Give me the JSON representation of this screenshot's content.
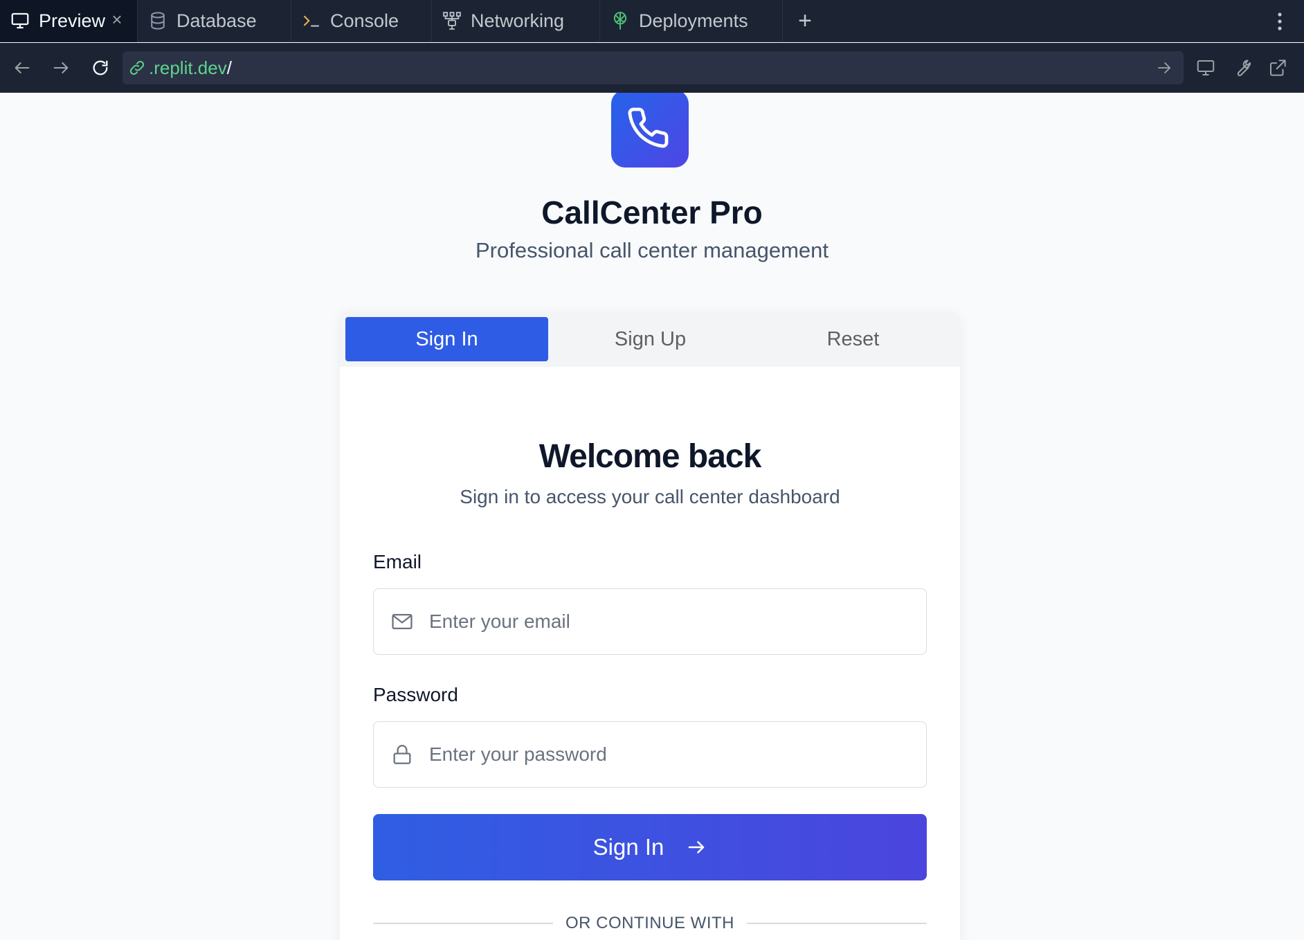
{
  "tabbar": {
    "tabs": [
      {
        "label": "Preview",
        "icon": "monitor-icon",
        "active": true
      },
      {
        "label": "Database",
        "icon": "database-icon"
      },
      {
        "label": "Console",
        "icon": "terminal-icon"
      },
      {
        "label": "Networking",
        "icon": "network-icon"
      },
      {
        "label": "Deployments",
        "icon": "deployments-icon"
      }
    ],
    "add_label": "+",
    "close_label": "×"
  },
  "addressbar": {
    "url_domain": ".replit.dev",
    "url_path": "/"
  },
  "page": {
    "app_title": "CallCenter Pro",
    "app_subtitle": "Professional call center management",
    "tabs": [
      {
        "label": "Sign In",
        "active": true
      },
      {
        "label": "Sign Up"
      },
      {
        "label": "Reset"
      }
    ],
    "welcome_title": "Welcome back",
    "welcome_subtitle": "Sign in to access your call center dashboard",
    "email": {
      "label": "Email",
      "placeholder": "Enter your email",
      "value": ""
    },
    "password": {
      "label": "Password",
      "placeholder": "Enter your password",
      "value": ""
    },
    "submit_label": "Sign In",
    "divider_text": "OR CONTINUE WITH"
  },
  "colors": {
    "chrome_bg": "#1c2333",
    "accent": "#2f5ce5",
    "url_green": "#5ed48c"
  }
}
